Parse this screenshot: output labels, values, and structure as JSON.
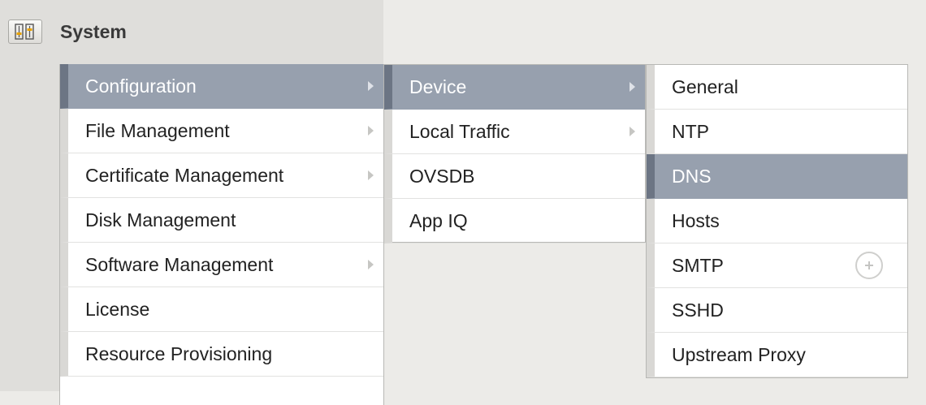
{
  "header": {
    "icon": "system-icon",
    "title": "System"
  },
  "menu_configuration": {
    "items": [
      {
        "label": "Configuration",
        "active": true,
        "submenu": true
      },
      {
        "label": "File Management",
        "submenu": true
      },
      {
        "label": "Certificate Management",
        "submenu": true
      },
      {
        "label": "Disk Management",
        "submenu": false
      },
      {
        "label": "Software Management",
        "submenu": true
      },
      {
        "label": "License",
        "submenu": false
      },
      {
        "label": "Resource Provisioning",
        "submenu": false
      }
    ]
  },
  "menu_device": {
    "items": [
      {
        "label": "Device",
        "active": true,
        "submenu": true
      },
      {
        "label": "Local Traffic",
        "submenu": true
      },
      {
        "label": "OVSDB",
        "submenu": false
      },
      {
        "label": "App IQ",
        "submenu": false
      }
    ]
  },
  "menu_device_items": {
    "items": [
      {
        "label": "General"
      },
      {
        "label": "NTP"
      },
      {
        "label": "DNS",
        "active": true
      },
      {
        "label": "Hosts"
      },
      {
        "label": "SMTP",
        "action_icon": "add-circle-icon"
      },
      {
        "label": "SSHD"
      },
      {
        "label": "Upstream Proxy"
      }
    ]
  },
  "colors": {
    "active_background": "#97a0ae",
    "active_accent": "#6c7584",
    "panel_background": "#dfdedb",
    "page_background": "#ecebe8"
  }
}
